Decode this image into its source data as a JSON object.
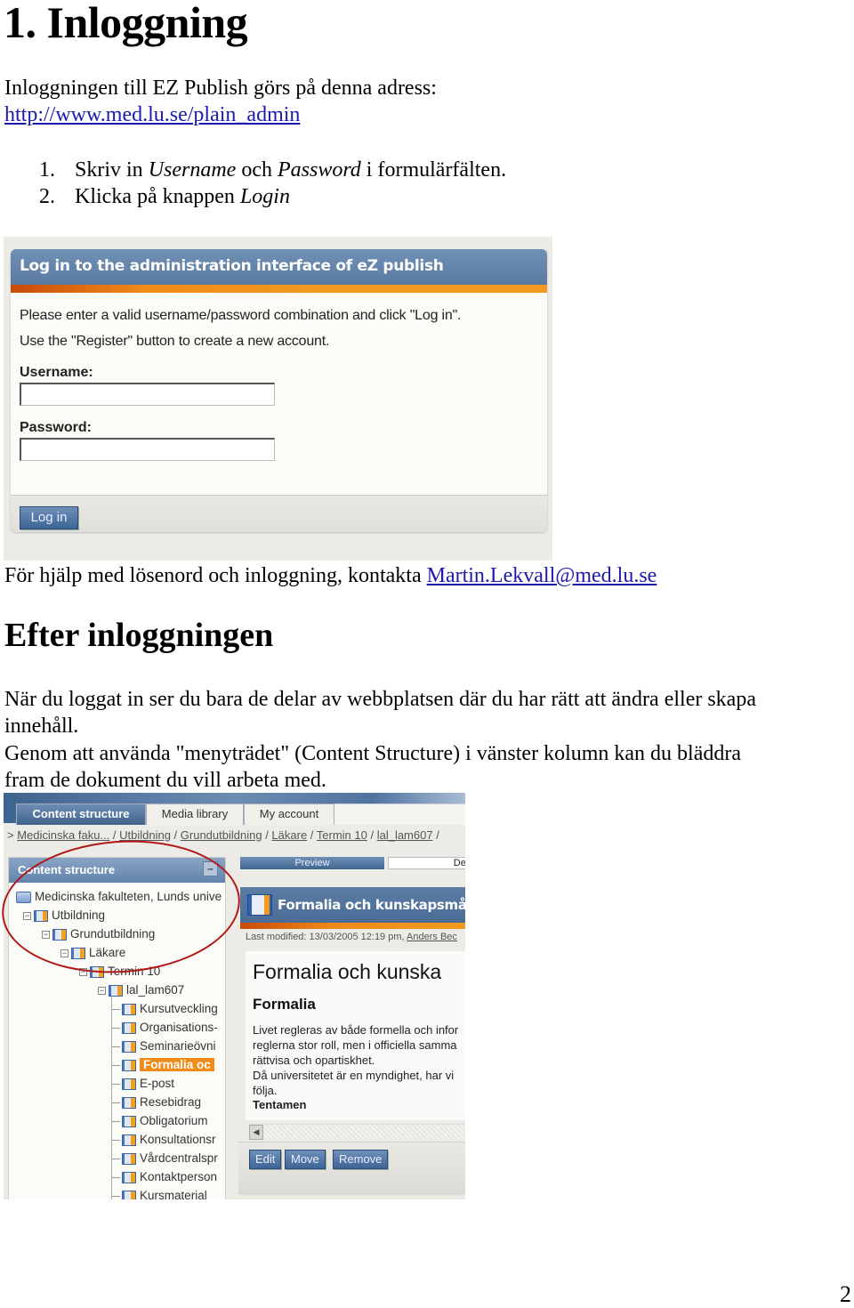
{
  "heading": "1. Inloggning",
  "intro": "Inloggningen till EZ Publish görs på denna adress:",
  "login_url": "http://www.med.lu.se/plain_admin",
  "steps": [
    {
      "num": "1.",
      "pre": "Skriv in ",
      "em1": "Username",
      "mid": " och ",
      "em2": "Password",
      "post": " i formulärfälten."
    },
    {
      "num": "2.",
      "pre": "Klicka på knappen ",
      "em1": "Login"
    }
  ],
  "login_screen": {
    "title": "Log in to the administration interface of eZ publish",
    "message_1": "Please enter a valid username/password combination and click \"Log in\".",
    "message_2": "Use the \"Register\" button to create a new account.",
    "username_label": "Username:",
    "username_value": "",
    "password_label": "Password:",
    "password_value": "",
    "login_button": "Log in"
  },
  "help_text": "För hjälp med lösenord och inloggning, kontakta ",
  "help_email": "Martin.Lekvall@med.lu.se",
  "subheading": "Efter inloggningen",
  "after_p1_line1": "När du loggat in ser du bara de delar av webbplatsen där du har rätt att ändra eller skapa",
  "after_p1_line2": "innehåll.",
  "after_p2_line1": "Genom att använda \"menyträdet\" (Content Structure) i vänster kolumn kan du bläddra",
  "after_p2_line2": "fram de dokument du vill arbeta med.",
  "admin_screen": {
    "tabs": [
      "Content structure",
      "Media library",
      "My account"
    ],
    "breadcrumb_prefix": ">",
    "breadcrumb": [
      "Medicinska faku...",
      "Utbildning",
      "Grundutbildning",
      "Läkare",
      "Termin 10",
      "lal_lam607"
    ],
    "breadcrumb_sep": " / ",
    "panel_title": "Content structure",
    "panel_minimize": "–",
    "tree": [
      {
        "label": "Medicinska fakulteten, Lunds unive",
        "depth": 0,
        "type": "folder"
      },
      {
        "label": "Utbildning",
        "depth": 1,
        "type": "expanded"
      },
      {
        "label": "Grundutbildning",
        "depth": 2,
        "type": "expanded"
      },
      {
        "label": "Läkare",
        "depth": 3,
        "type": "expanded"
      },
      {
        "label": "Termin 10",
        "depth": 4,
        "type": "expanded"
      },
      {
        "label": "lal_lam607",
        "depth": 5,
        "type": "expanded"
      },
      {
        "label": "Kursutveckling",
        "depth": 6,
        "type": "leaf"
      },
      {
        "label": "Organisations-",
        "depth": 6,
        "type": "leaf"
      },
      {
        "label": "Seminarieövni",
        "depth": 6,
        "type": "leaf"
      },
      {
        "label": "Formalia oc",
        "depth": 6,
        "type": "leaf",
        "selected": true
      },
      {
        "label": "E-post",
        "depth": 6,
        "type": "leaf"
      },
      {
        "label": "Resebidrag",
        "depth": 6,
        "type": "leaf"
      },
      {
        "label": "Obligatorium",
        "depth": 6,
        "type": "leaf"
      },
      {
        "label": "Konsultationsr",
        "depth": 6,
        "type": "leaf"
      },
      {
        "label": "Vårdcentralspr",
        "depth": 6,
        "type": "leaf"
      },
      {
        "label": "Kontaktperson",
        "depth": 6,
        "type": "leaf"
      },
      {
        "label": "Kursmaterial",
        "depth": 6,
        "type": "leaf"
      }
    ],
    "view_tabs": [
      "Preview",
      "Deta"
    ],
    "object_title": "Formalia och kunskapsmål [V",
    "last_modified_label": "Last modified: 13/03/2005 12:19 pm, ",
    "last_modified_author": "Anders Bec",
    "content_h1": "Formalia och kunska",
    "content_h2": "Formalia",
    "content_lines": [
      "Livet regleras av både formella och infor",
      "reglerna stor roll, men i officiella samma",
      "rättvisa och opartiskhet.",
      "Då universitetet är en myndighet, har vi",
      "följa."
    ],
    "content_h3": "Tentamen",
    "actions": [
      "Edit",
      "Move",
      "Remove"
    ]
  },
  "page_number": "2",
  "colors": {
    "link": "#1a1ab0",
    "header_blue": "#5a7aa2",
    "accent_orange": "#f08a18",
    "annotation_red": "#b01818"
  }
}
